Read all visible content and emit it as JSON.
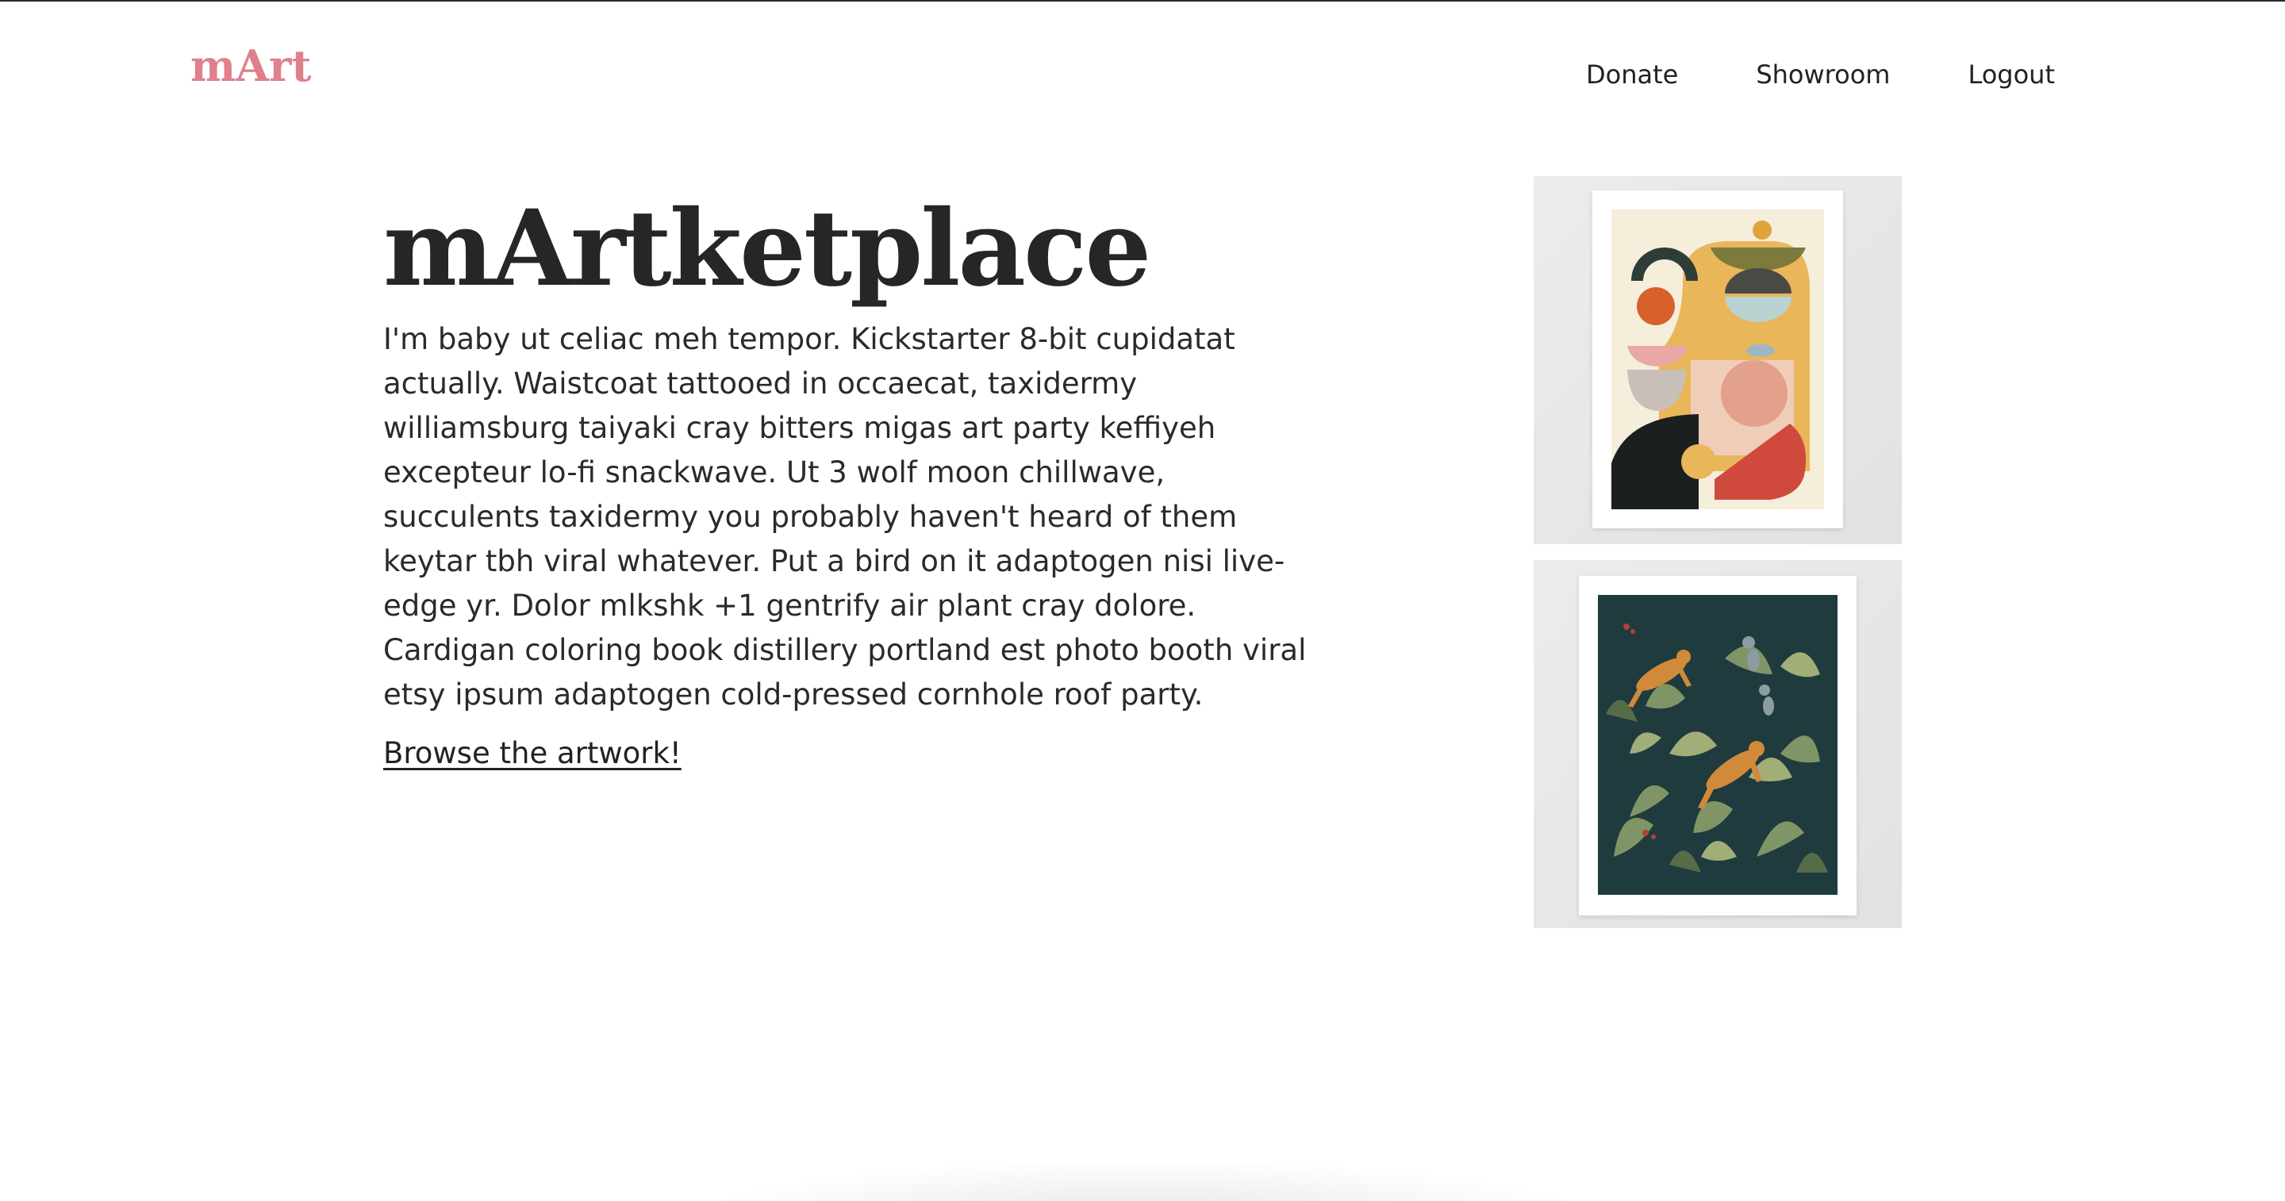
{
  "header": {
    "logo": "mArt",
    "nav": {
      "donate": "Donate",
      "showroom": "Showroom",
      "logout": "Logout"
    }
  },
  "hero": {
    "title": "mArtketplace",
    "body": "I'm baby ut celiac meh tempor. Kickstarter 8-bit cupidatat actually. Waistcoat tattooed in occaecat, taxidermy williamsburg taiyaki cray bitters migas art party keffiyeh excepteur lo-fi snackwave. Ut 3 wolf moon chillwave, succulents taxidermy you probably haven't heard of them keytar tbh viral whatever. Put a bird on it adaptogen nisi live-edge yr. Dolor mlkshk +1 gentrify air plant cray dolore. Cardigan coloring book distillery portland est photo booth viral etsy ipsum adaptogen cold-pressed cornhole roof party.",
    "cta": "Browse the artwork!"
  },
  "colors": {
    "logo": "#e0808a",
    "text": "#222222",
    "card_bg": "#e6e6e6"
  }
}
